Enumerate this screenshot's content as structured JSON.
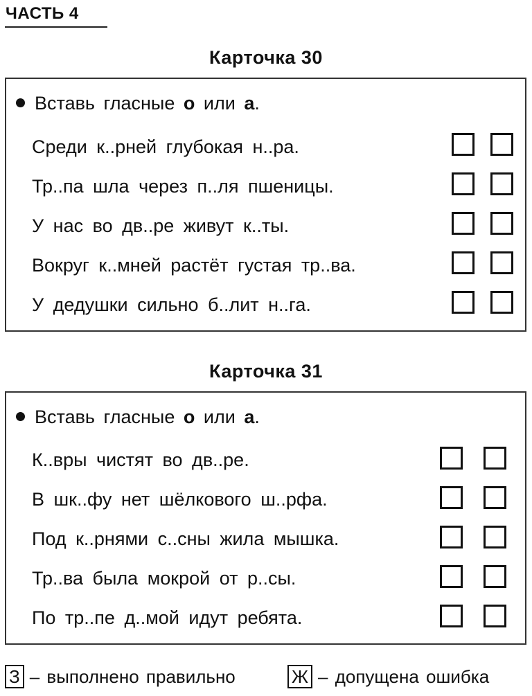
{
  "header": {
    "part_label": "ЧАСТЬ 4"
  },
  "cards": [
    {
      "title": "Карточка 30",
      "instruction": {
        "prefix": "Вставь гласные",
        "opt1": "о",
        "mid": "или",
        "opt2": "а",
        "suffix": "."
      },
      "rows": [
        "Среди к..рней глубокая н..ра.",
        "Тр..па шла через п..ля пшеницы.",
        "У нас во дв..ре живут к..ты.",
        "Вокруг к..мней растёт густая тр..ва.",
        "У дедушки сильно б..лит н..га."
      ]
    },
    {
      "title": "Карточка 31",
      "instruction": {
        "prefix": "Вставь гласные",
        "opt1": "о",
        "mid": "или",
        "opt2": "а",
        "suffix": "."
      },
      "rows": [
        "К..вры чистят во дв..ре.",
        "В шк..фу нет шёлкового ш..рфа.",
        "Под к..рнями с..сны жила мышка.",
        "Тр..ва была мокрой от р..сы.",
        "По тр..пе д..мой идут ребята."
      ]
    }
  ],
  "legend": {
    "correct": {
      "mark": "З",
      "text": "– выполнено правильно"
    },
    "error": {
      "mark": "Ж",
      "text": "– допущена ошибка"
    }
  }
}
